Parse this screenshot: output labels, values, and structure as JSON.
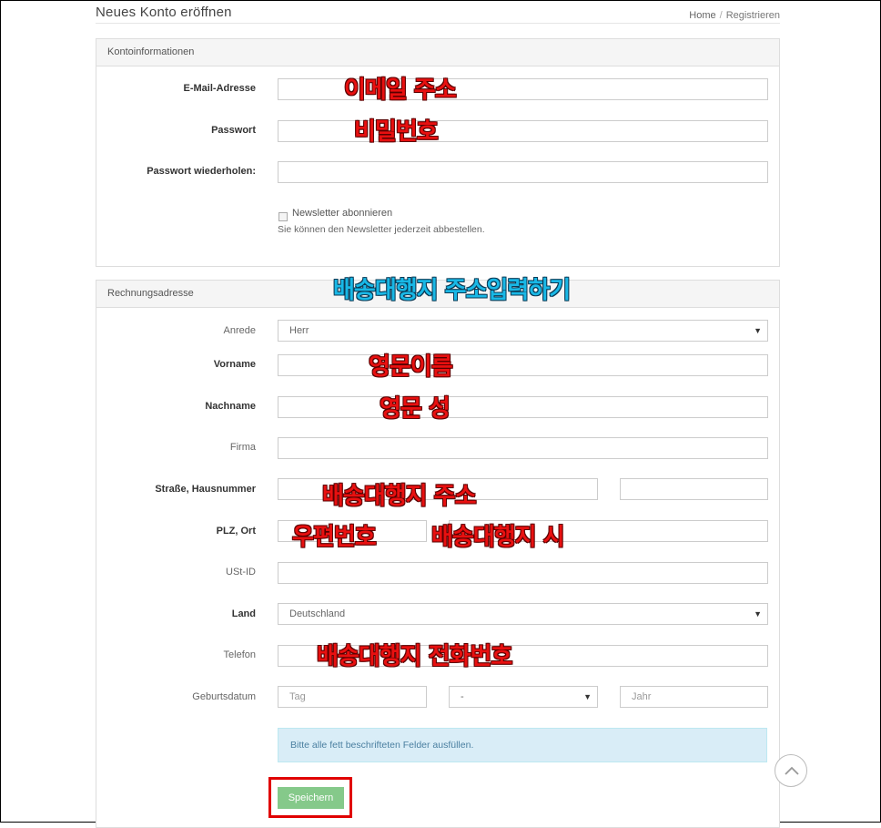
{
  "header": {
    "title": "Neues Konto eröffnen",
    "breadcrumb": {
      "home": "Home",
      "separator": "/",
      "current": "Registrieren"
    }
  },
  "account_panel": {
    "heading": "Kontoinformationen",
    "email_label": "E-Mail-Adresse",
    "password_label": "Passwort",
    "password_repeat_label": "Passwort wiederholen:",
    "newsletter_label": "Newsletter abonnieren",
    "newsletter_checked": false,
    "newsletter_hint": "Sie können den Newsletter jederzeit abbestellen."
  },
  "billing_panel": {
    "heading": "Rechnungsadresse",
    "salutation_label": "Anrede",
    "salutation_value": "Herr",
    "firstname_label": "Vorname",
    "lastname_label": "Nachname",
    "company_label": "Firma",
    "street_label": "Straße, Hausnummer",
    "zip_city_label": "PLZ, Ort",
    "vat_label": "USt-ID",
    "country_label": "Land",
    "country_value": "Deutschland",
    "phone_label": "Telefon",
    "birthday_label": "Geburtsdatum",
    "birthday_day_placeholder": "Tag",
    "birthday_month_value": "-",
    "birthday_year_placeholder": "Jahr",
    "required_notice": "Bitte alle fett beschrifteten Felder ausfüllen.",
    "save_label": "Speichern"
  },
  "annotations": {
    "email": "이메일 주소",
    "password": "비밀번호",
    "billing": "배송대행지 주소입력하기",
    "firstname": "영문이름",
    "lastname": "영문 성",
    "street": "배송대행지 주소",
    "zip": "우편번호",
    "city": "배송대행지 시",
    "phone": "배송대행지 전화번호"
  },
  "colors": {
    "annotation_red": "#e81010",
    "annotation_blue": "#19b8e6",
    "save_button": "#85c98a",
    "highlight_box": "#e00000",
    "info_alert": "#d9edf7"
  },
  "icons": {
    "select_arrow": "caret-down-icon",
    "scroll_top": "chevron-up-icon"
  }
}
